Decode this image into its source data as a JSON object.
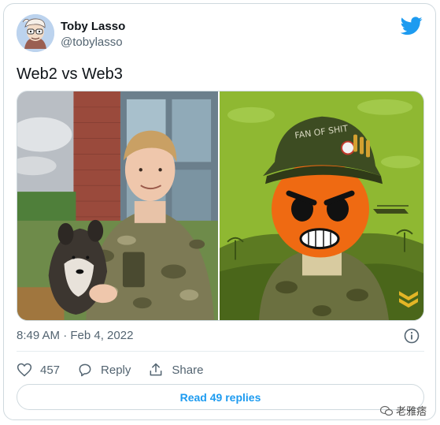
{
  "user": {
    "name": "Toby Lasso",
    "handle": "@tobylasso",
    "avatar_icon": "cartoon-avatar-icon"
  },
  "tweet": {
    "text": "Web2 vs Web3",
    "timestamp": "8:49 AM · Feb 4, 2022"
  },
  "media": {
    "left_image": "photo of man in camouflage uniform holding a puppy",
    "right_image": "cartoon orange face in soldier helmet and uniform",
    "helmet_text": "FAN OF SHIT"
  },
  "actions": {
    "like_count": "457",
    "reply_label": "Reply",
    "share_label": "Share"
  },
  "read_replies_label": "Read 49 replies",
  "watermark": "老雅痞",
  "colors": {
    "accent": "#1d9bf0",
    "secondary_text": "#536471",
    "border": "#cfd9de"
  }
}
